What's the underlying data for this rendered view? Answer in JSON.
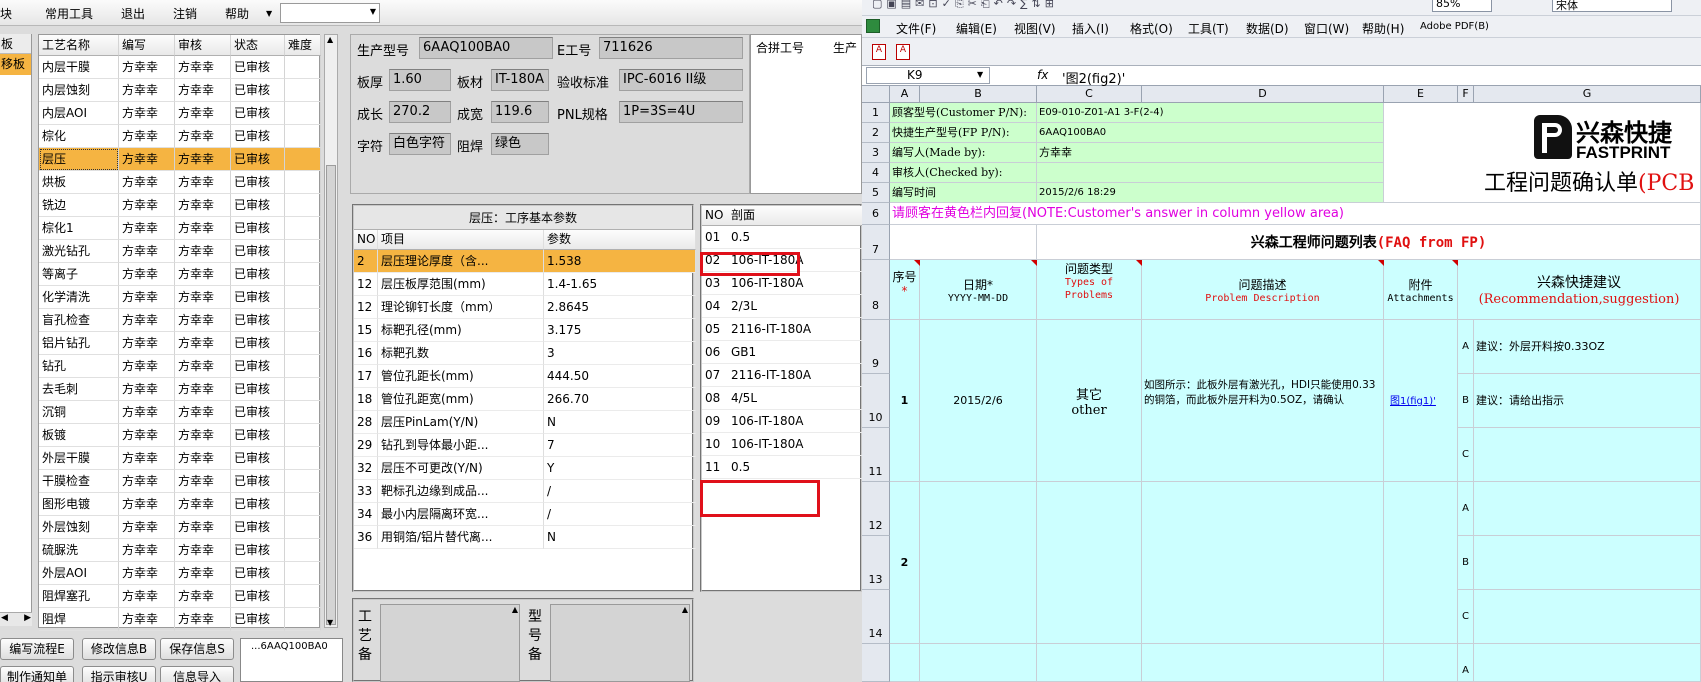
{
  "left_app": {
    "menu": [
      "块",
      "常用工具",
      "退出",
      "注销",
      "帮助"
    ],
    "menu_dropdown": "",
    "sidebar": {
      "header": "板",
      "selected": "移板"
    },
    "process_table": {
      "headers": [
        "工艺名称",
        "编写",
        "审核",
        "状态",
        "难度"
      ],
      "rows": [
        [
          "内层干膜",
          "方幸幸",
          "方幸幸",
          "已审核",
          ""
        ],
        [
          "内层蚀刻",
          "方幸幸",
          "方幸幸",
          "已审核",
          ""
        ],
        [
          "内层AOI",
          "方幸幸",
          "方幸幸",
          "已审核",
          ""
        ],
        [
          "棕化",
          "方幸幸",
          "方幸幸",
          "已审核",
          ""
        ],
        [
          "层压",
          "方幸幸",
          "方幸幸",
          "已审核",
          ""
        ],
        [
          "烘板",
          "方幸幸",
          "方幸幸",
          "已审核",
          ""
        ],
        [
          "铣边",
          "方幸幸",
          "方幸幸",
          "已审核",
          ""
        ],
        [
          "棕化1",
          "方幸幸",
          "方幸幸",
          "已审核",
          ""
        ],
        [
          "激光钻孔",
          "方幸幸",
          "方幸幸",
          "已审核",
          ""
        ],
        [
          "等离子",
          "方幸幸",
          "方幸幸",
          "已审核",
          ""
        ],
        [
          "化学清洗",
          "方幸幸",
          "方幸幸",
          "已审核",
          ""
        ],
        [
          "盲孔检查",
          "方幸幸",
          "方幸幸",
          "已审核",
          ""
        ],
        [
          "铝片钻孔",
          "方幸幸",
          "方幸幸",
          "已审核",
          ""
        ],
        [
          "钻孔",
          "方幸幸",
          "方幸幸",
          "已审核",
          ""
        ],
        [
          "去毛刺",
          "方幸幸",
          "方幸幸",
          "已审核",
          ""
        ],
        [
          "沉铜",
          "方幸幸",
          "方幸幸",
          "已审核",
          ""
        ],
        [
          "板镀",
          "方幸幸",
          "方幸幸",
          "已审核",
          ""
        ],
        [
          "外层干膜",
          "方幸幸",
          "方幸幸",
          "已审核",
          ""
        ],
        [
          "干膜检查",
          "方幸幸",
          "方幸幸",
          "已审核",
          ""
        ],
        [
          "图形电镀",
          "方幸幸",
          "方幸幸",
          "已审核",
          ""
        ],
        [
          "外层蚀刻",
          "方幸幸",
          "方幸幸",
          "已审核",
          ""
        ],
        [
          "硫脲洗",
          "方幸幸",
          "方幸幸",
          "已审核",
          ""
        ],
        [
          "外层AOI",
          "方幸幸",
          "方幸幸",
          "已审核",
          ""
        ],
        [
          "阻焊塞孔",
          "方幸幸",
          "方幸幸",
          "已审核",
          ""
        ],
        [
          "阻焊",
          "方幸幸",
          "方幸幸",
          "已审核",
          ""
        ]
      ],
      "selected_index": 4
    },
    "buttons": {
      "write_flow": "编写流程E",
      "edit_info": "修改信息B",
      "save_info": "保存信息S",
      "make_notice": "制作通知单",
      "instruction_audit": "指示审核U",
      "import_info": "信息导入"
    },
    "log_text": "...6AAQ100BA0",
    "info": {
      "prod_model_label": "生产型号",
      "prod_model": "6AAQ100BA0",
      "e_code_label": "E工号",
      "e_code": "711626",
      "thickness_label": "板厚",
      "thickness": "1.60",
      "material_label": "板材",
      "material": "IT-180A",
      "standard_label": "验收标准",
      "standard": "IPC-6016 II级",
      "length_label": "成长",
      "length": "270.2",
      "width_label": "成宽",
      "width": "119.6",
      "pnl_label": "PNL规格",
      "pnl": "1P=3S=4U",
      "char_label": "字符",
      "char": "白色字符",
      "mask_label": "阻焊",
      "mask": "绿色"
    },
    "combine": {
      "h1": "合拼工号",
      "h2": "生产"
    },
    "params": {
      "title": "层压：工序基本参数",
      "headers": [
        "NO",
        "项目",
        "参数"
      ],
      "rows": [
        [
          "2",
          "层压理论厚度（含...",
          "1.538"
        ],
        [
          "12",
          "层压板厚范围(mm)",
          "1.4-1.65"
        ],
        [
          "12",
          "理论铆钉长度（mm）",
          "2.8645"
        ],
        [
          "15",
          "标靶孔径(mm)",
          "3.175"
        ],
        [
          "16",
          "标靶孔数",
          "3"
        ],
        [
          "17",
          "管位孔距长(mm)",
          "444.50"
        ],
        [
          "18",
          "管位孔距宽(mm)",
          "266.70"
        ],
        [
          "28",
          "层压PinLam(Y/N)",
          "N"
        ],
        [
          "29",
          "钻孔到导体最小距...",
          "7"
        ],
        [
          "32",
          "层压不可更改(Y/N)",
          "Y"
        ],
        [
          "33",
          "靶标孔边缘到成品...",
          "/"
        ],
        [
          "34",
          "最小内层隔离环宽...",
          "/"
        ],
        [
          "36",
          "用铜箔/铝片替代离...",
          "N"
        ]
      ]
    },
    "profile": {
      "headers": [
        "NO",
        "剖面"
      ],
      "rows": [
        [
          "01",
          "0.5"
        ],
        [
          "02",
          "106-IT-180A"
        ],
        [
          "03",
          "106-IT-180A"
        ],
        [
          "04",
          "2/3L"
        ],
        [
          "05",
          "2116-IT-180A"
        ],
        [
          "06",
          "GB1"
        ],
        [
          "07",
          "2116-IT-180A"
        ],
        [
          "08",
          "4/5L"
        ],
        [
          "09",
          "106-IT-180A"
        ],
        [
          "10",
          "106-IT-180A"
        ],
        [
          "11",
          "0.5"
        ]
      ]
    },
    "bottom": {
      "label1": "工艺备",
      "label2": "型号备"
    }
  },
  "excel": {
    "menu": [
      "文件(F)",
      "编辑(E)",
      "视图(V)",
      "插入(I)",
      "格式(O)",
      "工具(T)",
      "数据(D)",
      "窗口(W)",
      "帮助(H)",
      "Adobe PDF(B)"
    ],
    "zoom": "85%",
    "font": "宋体",
    "name_box": "K9",
    "fx": "fx",
    "formula": "'图2(fig2)'",
    "columns": [
      "A",
      "B",
      "C",
      "D",
      "E",
      "F",
      "G"
    ],
    "row_numbers": [
      "1",
      "2",
      "3",
      "4",
      "5",
      "6",
      "7",
      "8",
      "9",
      "10",
      "11",
      "12",
      "13",
      "14"
    ],
    "cust_pn_label": "顾客型号(Customer P/N):",
    "cust_pn": "E09-010-Z01-A1 3-F(2-4)",
    "fp_pn_label": "快捷生产型号(FP P/N):",
    "fp_pn": "6AAQ100BA0",
    "made_by_label": "编写人(Made by):",
    "made_by": "方幸幸",
    "checked_by_label": "审核人(Checked by):",
    "checked_by": "",
    "time_label": "编写时间",
    "time": "2015/2/6 18:29",
    "logo_cn": "兴森快捷",
    "logo_en": "FASTPRINT",
    "doc_title": "工程问题确认单",
    "doc_title_suffix": "(PCB",
    "note": "请顾客在黄色栏内回复(NOTE:Customer's answer in column yellow area)",
    "faq_title": "兴森工程师问题列表",
    "faq_title_en": "(FAQ from FP)",
    "hdr_seq": "序号",
    "hdr_date": "日期*",
    "hdr_date_fmt": "YYYY-MM-DD",
    "hdr_type": "问题类型",
    "hdr_type_en": "Types of Problems",
    "hdr_desc": "问题描述",
    "hdr_desc_en": "Problem Description",
    "hdr_attach": "附件",
    "hdr_attach_en": "Attachments",
    "hdr_sugg": "兴森快捷建议",
    "hdr_sugg_en": "(Recommendation,suggestion)",
    "q1": {
      "seq": "1",
      "date": "2015/2/6",
      "type": "其它",
      "type_en": "other",
      "desc": "如图所示：此板外层有激光孔，HDI只能使用0.33的铜箔，而此板外层开料为0.5OZ，请确认",
      "attach": "图1(fig1)'",
      "options": [
        {
          "letter": "A",
          "text": "建议：外层开料按0.33OZ"
        },
        {
          "letter": "B",
          "text": "建议：请给出指示"
        },
        {
          "letter": "C",
          "text": ""
        }
      ]
    },
    "q2": {
      "seq": "2",
      "options": [
        {
          "letter": "A"
        },
        {
          "letter": "B"
        },
        {
          "letter": "C"
        }
      ]
    },
    "q3": {
      "options": [
        {
          "letter": "A"
        }
      ]
    }
  }
}
